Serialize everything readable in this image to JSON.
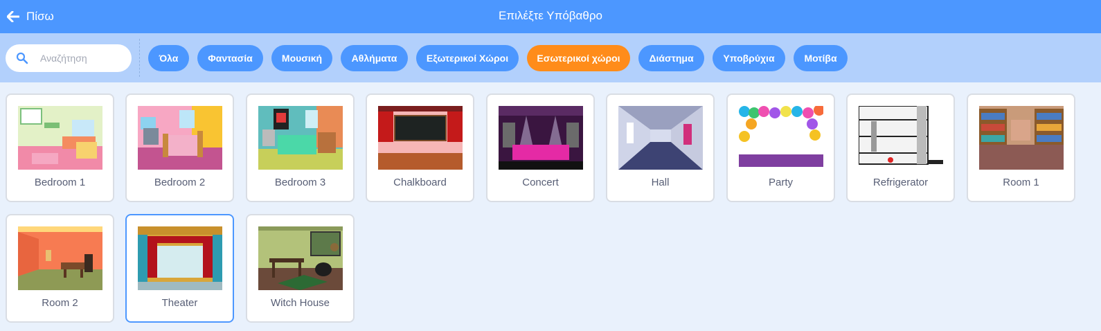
{
  "header": {
    "back_label": "Πίσω",
    "title": "Επιλέξτε Υπόβαθρο",
    "back_icon": "arrow-left-icon"
  },
  "search": {
    "placeholder": "Αναζήτηση",
    "value": "",
    "icon": "search-icon"
  },
  "tags": [
    {
      "label": "Όλα",
      "active": false
    },
    {
      "label": "Φαντασία",
      "active": false
    },
    {
      "label": "Μουσική",
      "active": false
    },
    {
      "label": "Αθλήματα",
      "active": false
    },
    {
      "label": "Εξωτερικοί Χώροι",
      "active": false
    },
    {
      "label": "Εσωτερικοί χώροι",
      "active": true
    },
    {
      "label": "Διάστημα",
      "active": false
    },
    {
      "label": "Υποβρύχια",
      "active": false
    },
    {
      "label": "Μοτίβα",
      "active": false
    }
  ],
  "backdrops": [
    {
      "name": "Bedroom 1",
      "selected": false
    },
    {
      "name": "Bedroom 2",
      "selected": false
    },
    {
      "name": "Bedroom 3",
      "selected": false
    },
    {
      "name": "Chalkboard",
      "selected": false
    },
    {
      "name": "Concert",
      "selected": false
    },
    {
      "name": "Hall",
      "selected": false
    },
    {
      "name": "Party",
      "selected": false
    },
    {
      "name": "Refrigerator",
      "selected": false
    },
    {
      "name": "Room 1",
      "selected": false
    },
    {
      "name": "Room 2",
      "selected": false
    },
    {
      "name": "Theater",
      "selected": true
    },
    {
      "name": "Witch House",
      "selected": false
    }
  ],
  "colors": {
    "header": "#4c97ff",
    "filter_bar": "#b2d0fc",
    "active_tag": "#ff8c1a",
    "background": "#e9f1fc",
    "text": "#575e75"
  }
}
